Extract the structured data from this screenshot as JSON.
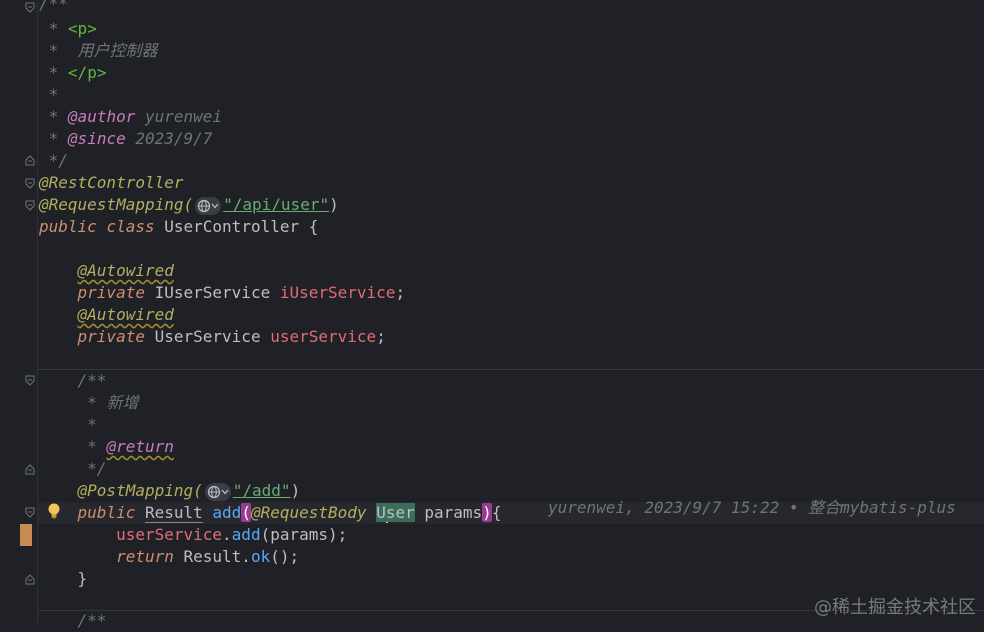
{
  "doc_comment": {
    "open": "/**",
    "star": "*",
    "p_open": "<p>",
    "desc": "用户控制器",
    "p_close": "</p>",
    "author_tag": "@author",
    "author": "yurenwei",
    "since_tag": "@since",
    "since": "2023/9/7",
    "close": "*/"
  },
  "class_header": {
    "rest_controller": "@RestController",
    "request_mapping": "@RequestMapping(",
    "mapping_path": "\"/api/user\"",
    "close_paren": ")",
    "public": "public",
    "class": "class",
    "class_name": "UserController",
    "brace": "{"
  },
  "fields": [
    {
      "annotation": "@Autowired",
      "modifier": "private",
      "type": "IUserService",
      "name": "iUserService",
      "end": ";"
    },
    {
      "annotation": "@Autowired",
      "modifier": "private",
      "type": "UserService",
      "name": "userService",
      "end": ";"
    }
  ],
  "method_doc": {
    "open": "/**",
    "star": "*",
    "desc": "新增",
    "return_tag": "@return",
    "close": "*/"
  },
  "method": {
    "post_mapping": "@PostMapping(",
    "path": "\"/add\"",
    "close_paren": ")",
    "public": "public",
    "return_type": "Result",
    "name": "add",
    "open_paren": "(",
    "param_annotation": "@RequestBody",
    "param_type_first": "U",
    "param_type_rest": "ser",
    "param_name": "params",
    "close_paren2": ")",
    "brace": "{",
    "body_line1_obj": "userService",
    "body_line1_dot": ".",
    "body_line1_call": "add",
    "body_line1_rest": "(params);",
    "return_kw": "return",
    "result_obj": "Result.",
    "ok_call": "ok",
    "ok_rest": "();",
    "close_brace": "}"
  },
  "next_doc_open": "/**",
  "blame": {
    "author": "yurenwei,",
    "date": "2023/9/7 15:22",
    "bullet": "•",
    "message_zh": "整合",
    "message_en": "mybatis-plus"
  },
  "watermark": "@稀土掘金技术社区",
  "icons": [
    "fold-icon",
    "globe-icon",
    "chevron-down-icon",
    "bulb-icon"
  ],
  "colors": {
    "background": "#1f2127",
    "keyword": "#cf8e6d",
    "annotation": "#b3ae60",
    "string": "#6aab73",
    "method": "#56a8f5",
    "field": "#c77dbb"
  }
}
